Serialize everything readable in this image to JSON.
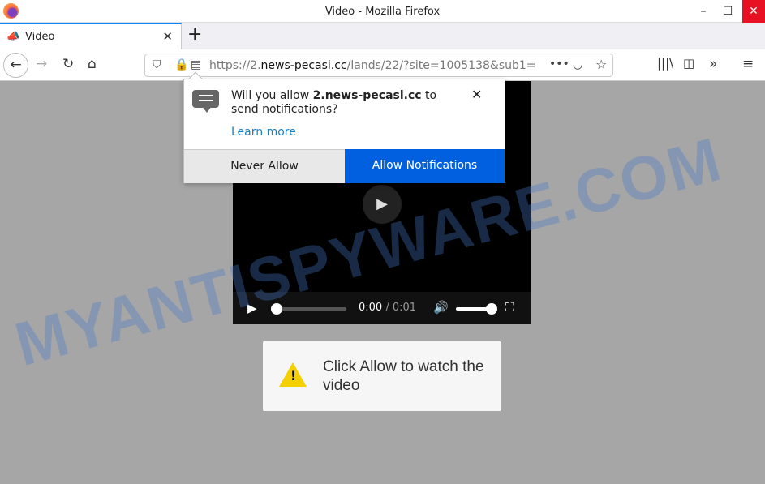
{
  "window": {
    "title": "Video - Mozilla Firefox",
    "minimize": "–",
    "maximize": "☐",
    "close": "✕"
  },
  "tab": {
    "label": "Video",
    "close": "✕",
    "new_tab": "+"
  },
  "navbar": {
    "url_prefix": "https://2.",
    "url_domain": "news-pecasi.cc",
    "url_rest": "/lands/22/?site=1005138&sub1=",
    "more": "•••"
  },
  "popup": {
    "msg_pre": "Will you allow ",
    "msg_domain": "2.news-pecasi.cc",
    "msg_post": " to send notifications?",
    "learn_more": "Learn more",
    "never_allow": "Never Allow",
    "allow": "Allow Notifications",
    "close": "✕"
  },
  "video": {
    "current_time": "0:00",
    "separator": " / ",
    "duration": "0:01",
    "progress": 0,
    "volume": 1.0
  },
  "message": {
    "text": "Click Allow to watch the video"
  },
  "watermark": "MYANTISPYWARE.COM",
  "colors": {
    "accent": "#0060df",
    "close_red": "#e81123",
    "warning": "#f5d000"
  }
}
